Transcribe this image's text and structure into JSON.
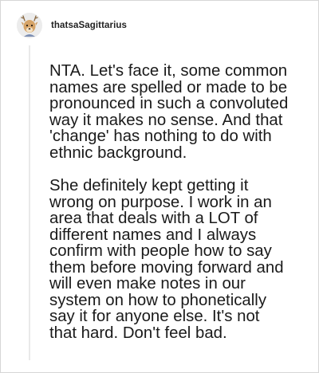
{
  "comment": {
    "author": "thatsaSagittarius",
    "avatar_icon": "deer-avatar-icon",
    "paragraphs": [
      "NTA. Let's face it, some common\nnames are spelled or made to be\npronounced in such a convoluted\nway it makes no sense. And that\n'change' has nothing to do with\nethnic background.",
      "She definitely kept getting it\nwrong on purpose. I work in an\narea that deals with a LOT of\ndifferent names and I always\nconfirm with people how to say\nthem before moving forward and\nwill even make notes in our\nsystem on how to phonetically\nsay it for anyone else. It's not\nthat hard. Don't feel bad."
    ]
  },
  "colors": {
    "background": "#ffffff",
    "border": "#d6d6d6",
    "text": "#1a1a1a",
    "thread_line": "#e9e9e9"
  }
}
